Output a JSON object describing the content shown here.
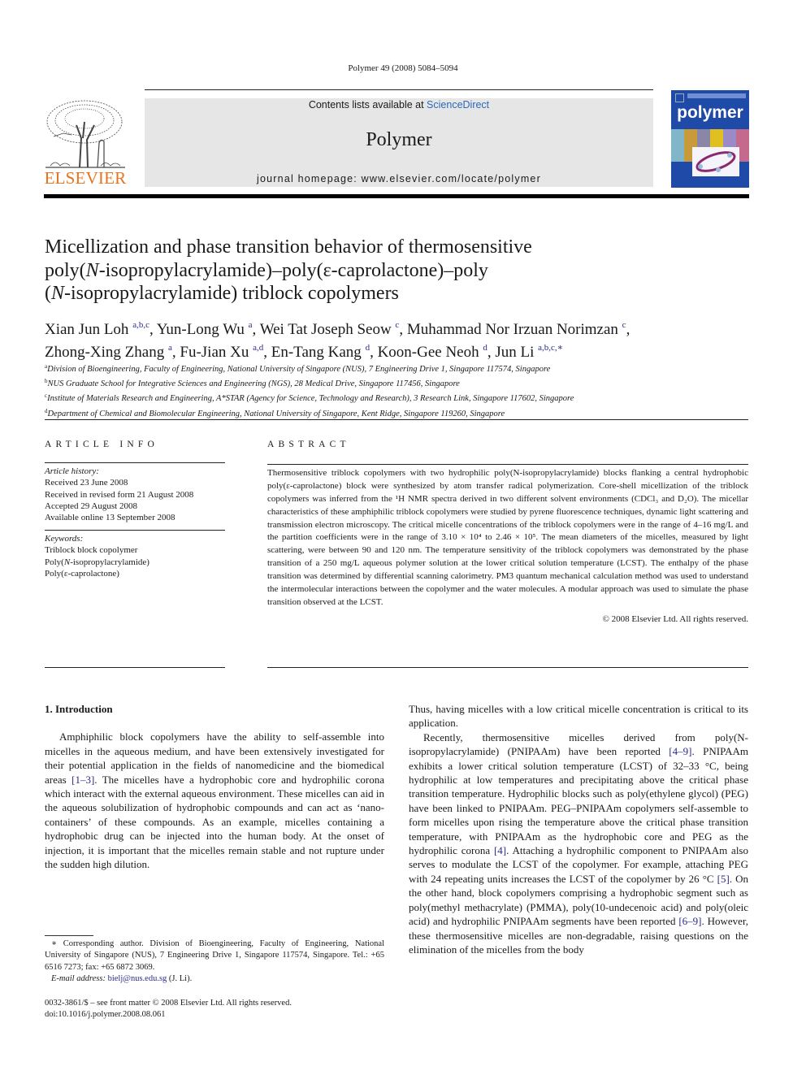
{
  "journal_ref": "Polymer 49 (2008) 5084–5094",
  "header": {
    "publisher_logo_text": "ELSEVIER",
    "contents_prefix": "Contents lists available at ",
    "contents_link": "ScienceDirect",
    "journal_name": "Polymer",
    "homepage": "journal homepage: www.elsevier.com/locate/polymer",
    "cover_title": "polymer",
    "colors": {
      "elsevier_orange": "#e8731c",
      "cover_blue": "#1f4aa8",
      "link_blue": "#2a2a8c",
      "banner_gray": "#e6e6e6"
    }
  },
  "article": {
    "title_lines": [
      "Micellization and phase transition behavior of thermosensitive",
      "poly(N-isopropylacrylamide)–poly(ε-caprolactone)–poly",
      "(N-isopropylacrylamide) triblock copolymers"
    ],
    "authors": [
      {
        "name": "Xian Jun Loh",
        "sup": "a,b,c"
      },
      {
        "name": "Yun-Long Wu",
        "sup": "a"
      },
      {
        "name": "Wei Tat Joseph Seow",
        "sup": "c"
      },
      {
        "name": "Muhammad Nor Irzuan Norimzan",
        "sup": "c"
      },
      {
        "name": "Zhong-Xing Zhang",
        "sup": "a"
      },
      {
        "name": "Fu-Jian Xu",
        "sup": "a,d"
      },
      {
        "name": "En-Tang Kang",
        "sup": "d"
      },
      {
        "name": "Koon-Gee Neoh",
        "sup": "d"
      },
      {
        "name": "Jun Li",
        "sup": "a,b,c,∗"
      }
    ],
    "affiliations": [
      {
        "mark": "a",
        "text": "Division of Bioengineering, Faculty of Engineering, National University of Singapore (NUS), 7 Engineering Drive 1, Singapore 117574, Singapore"
      },
      {
        "mark": "b",
        "text": "NUS Graduate School for Integrative Sciences and Engineering (NGS), 28 Medical Drive, Singapore 117456, Singapore"
      },
      {
        "mark": "c",
        "text": "Institute of Materials Research and Engineering, A*STAR (Agency for Science, Technology and Research), 3 Research Link, Singapore 117602, Singapore"
      },
      {
        "mark": "d",
        "text": "Department of Chemical and Biomolecular Engineering, National University of Singapore, Kent Ridge, Singapore 119260, Singapore"
      }
    ]
  },
  "article_info": {
    "heading": "ARTICLE INFO",
    "history_label": "Article history:",
    "history": [
      "Received 23 June 2008",
      "Received in revised form 21 August 2008",
      "Accepted 29 August 2008",
      "Available online 13 September 2008"
    ],
    "keywords_label": "Keywords:",
    "keywords": [
      "Triblock block copolymer",
      "Poly(N-isopropylacrylamide)",
      "Poly(ε-caprolactone)"
    ]
  },
  "abstract": {
    "heading": "ABSTRACT",
    "text": "Thermosensitive triblock copolymers with two hydrophilic poly(N-isopropylacrylamide) blocks flanking a central hydrophobic poly(ε-caprolactone) block were synthesized by atom transfer radical polymerization. Core-shell micellization of the triblock copolymers was inferred from the ¹H NMR spectra derived in two different solvent environments (CDCl₃ and D₂O). The micellar characteristics of these amphiphilic triblock copolymers were studied by pyrene fluorescence techniques, dynamic light scattering and transmission electron microscopy. The critical micelle concentrations of the triblock copolymers were in the range of 4–16 mg/L and the partition coefficients were in the range of 3.10 × 10⁴ to 2.46 × 10⁵. The mean diameters of the micelles, measured by light scattering, were between 90 and 120 nm. The temperature sensitivity of the triblock copolymers was demonstrated by the phase transition of a 250 mg/L aqueous polymer solution at the lower critical solution temperature (LCST). The enthalpy of the phase transition was determined by differential scanning calorimetry. PM3 quantum mechanical calculation method was used to understand the intermolecular interactions between the copolymer and the water molecules. A modular approach was used to simulate the phase transition observed at the LCST.",
    "copyright": "© 2008 Elsevier Ltd. All rights reserved."
  },
  "body": {
    "section_heading": "1.  Introduction",
    "left_para_1": [
      {
        "t": "Amphiphilic block copolymers have the ability to self-assemble into micelles in the aqueous medium, and have been extensively investigated for their potential application in the fields of nanomedicine and the biomedical areas "
      },
      {
        "ref": "[1–3]"
      },
      {
        "t": ". The micelles have a hydrophobic core and hydrophilic corona which interact with the external aqueous environment. These micelles can aid in the aqueous solubilization of hydrophobic compounds and can act as ‘nano-containers’ of these compounds. As an example, micelles containing a hydrophobic drug can be injected into the human body. At the onset of injection, it is important that the micelles remain stable and not rupture under the sudden high dilution."
      }
    ],
    "right_para_1": "Thus, having micelles with a low critical micelle concentration is critical to its application.",
    "right_para_2": [
      {
        "t": "Recently, thermosensitive micelles derived from poly(N-isopropylacrylamide) (PNIPAAm) have been reported "
      },
      {
        "ref": "[4–9]"
      },
      {
        "t": ". PNIPAAm exhibits a lower critical solution temperature (LCST) of 32–33 °C, being hydrophilic at low temperatures and precipitating above the critical phase transition temperature. Hydrophilic blocks such as poly(ethylene glycol) (PEG) have been linked to PNIPAAm. PEG–PNIPAAm copolymers self-assemble to form micelles upon rising the temperature above the critical phase transition temperature, with PNIPAAm as the hydrophobic core and PEG as the hydrophilic corona "
      },
      {
        "ref": "[4]"
      },
      {
        "t": ". Attaching a hydrophilic component to PNIPAAm also serves to modulate the LCST of the copolymer. For example, attaching PEG with 24 repeating units increases the LCST of the copolymer by 26 °C "
      },
      {
        "ref": "[5]"
      },
      {
        "t": ". On the other hand, block copolymers comprising a hydrophobic segment such as poly(methyl methacrylate) (PMMA), poly(10-undecenoic acid) and poly(oleic acid) and hydrophilic PNIPAAm segments have been reported "
      },
      {
        "ref": "[6–9]"
      },
      {
        "t": ". However, these thermosensitive micelles are non-degradable, raising questions on the elimination of the micelles from the body"
      }
    ]
  },
  "footnote": {
    "corresponding": "∗ Corresponding author. Division of Bioengineering, Faculty of Engineering, National University of Singapore (NUS), 7 Engineering Drive 1, Singapore 117574, Singapore. Tel.: +65 6516 7273; fax: +65 6872 3069.",
    "email_label": "E-mail address:",
    "email": "bielj@nus.edu.sg",
    "email_suffix": " (J. Li).",
    "issn": "0032-3861/$ – see front matter © 2008 Elsevier Ltd. All rights reserved.",
    "doi": "doi:10.1016/j.polymer.2008.08.061"
  }
}
